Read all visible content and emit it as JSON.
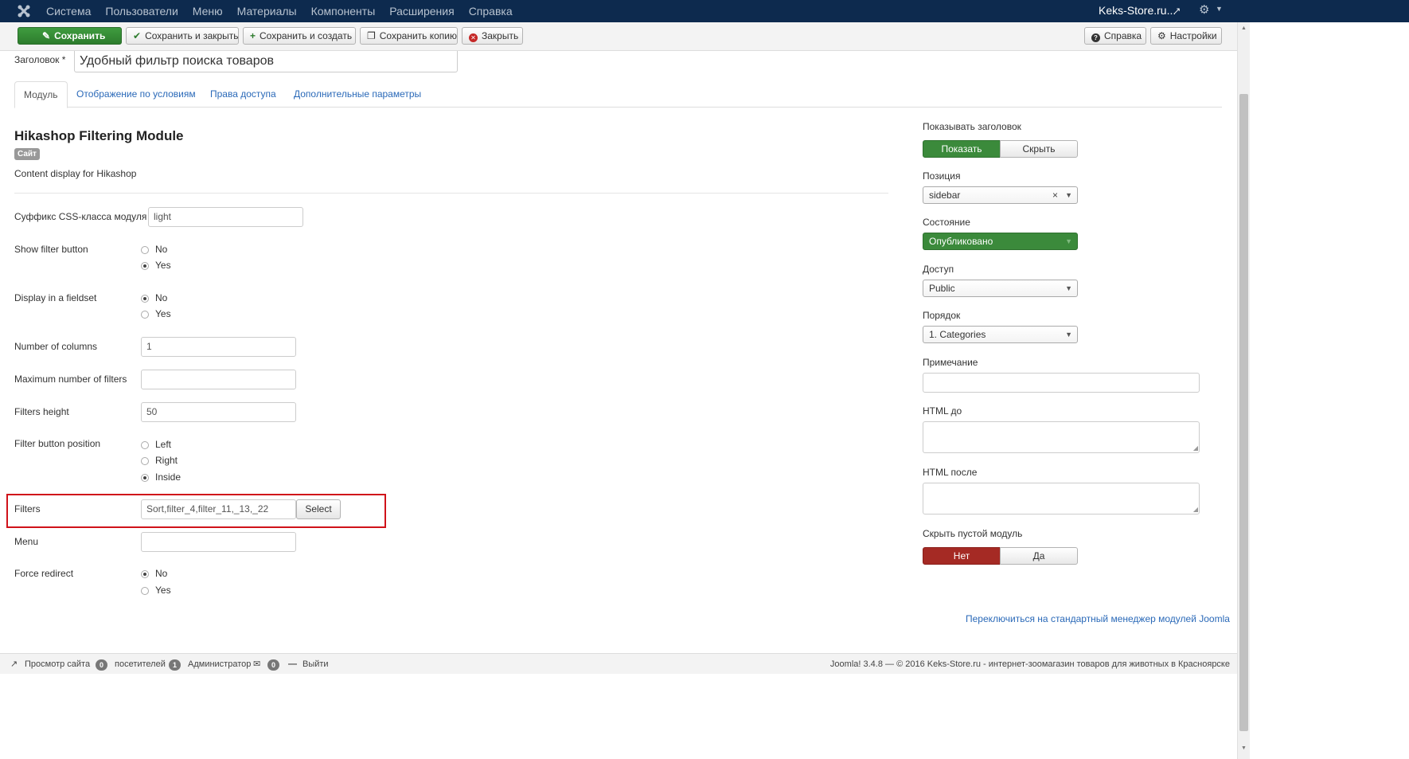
{
  "navbar": {
    "menu": [
      "Система",
      "Пользователи",
      "Меню",
      "Материалы",
      "Компоненты",
      "Расширения",
      "Справка"
    ],
    "site_name": "Keks-Store.ru..."
  },
  "toolbar": {
    "save": "Сохранить",
    "save_close": "Сохранить и закрыть",
    "save_new": "Сохранить и создать",
    "save_copy": "Сохранить копию",
    "close": "Закрыть",
    "help": "Справка",
    "options": "Настройки"
  },
  "title": {
    "label": "Заголовок *",
    "value": "Удобный фильтр поиска товаров"
  },
  "tabs": [
    "Модуль",
    "Отображение по условиям",
    "Права доступа",
    "Дополнительные параметры"
  ],
  "module": {
    "name": "Hikashop Filtering Module",
    "badge": "Сайт",
    "description": "Content display for Hikashop"
  },
  "form": {
    "css_suffix": {
      "label": "Суффикс CSS-класса модуля",
      "value": "light"
    },
    "show_filter_button": {
      "label": "Show filter button",
      "options": [
        "No",
        "Yes"
      ],
      "selected": "Yes"
    },
    "display_fieldset": {
      "label": "Display in a fieldset",
      "options": [
        "No",
        "Yes"
      ],
      "selected": "No"
    },
    "num_columns": {
      "label": "Number of columns",
      "value": "1"
    },
    "max_filters": {
      "label": "Maximum number of filters",
      "value": ""
    },
    "filters_height": {
      "label": "Filters height",
      "value": "50"
    },
    "filter_button_position": {
      "label": "Filter button position",
      "options": [
        "Left",
        "Right",
        "Inside"
      ],
      "selected": "Inside"
    },
    "filters": {
      "label": "Filters",
      "value": "Sort,filter_4,filter_11,_13,_22",
      "button": "Select"
    },
    "menu": {
      "label": "Menu",
      "value": ""
    },
    "force_redirect": {
      "label": "Force redirect",
      "options": [
        "No",
        "Yes"
      ],
      "selected": "No"
    }
  },
  "sidebar": {
    "show_title": {
      "label": "Показывать заголовок",
      "on": "Показать",
      "off": "Скрыть",
      "selected": "Показать"
    },
    "position": {
      "label": "Позиция",
      "value": "sidebar"
    },
    "state": {
      "label": "Состояние",
      "value": "Опубликовано"
    },
    "access": {
      "label": "Доступ",
      "value": "Public"
    },
    "ordering": {
      "label": "Порядок",
      "value": "1. Categories"
    },
    "note": {
      "label": "Примечание",
      "value": ""
    },
    "html_before": {
      "label": "HTML до"
    },
    "html_after": {
      "label": "HTML после"
    },
    "hide_empty": {
      "label": "Скрыть пустой модуль",
      "on": "Нет",
      "off": "Да",
      "selected": "Нет"
    }
  },
  "switch_link": "Переключиться на стандартный менеджер модулей Joomla",
  "statusbar": {
    "view_site": "Просмотр сайта",
    "visitors_count": "0",
    "visitors_label": "посетителей",
    "admins_count": "1",
    "admins_label": "Администратор",
    "messages_count": "0",
    "logout": "Выйти",
    "copyright": "Joomla! 3.4.8 — © 2016 Keks-Store.ru - интернет-зоомагазин товаров для животных в Красноярске"
  },
  "colors": {
    "navbar": "#0d2a4e",
    "primary_green": "#3b8a3b",
    "danger_red": "#a52a24",
    "link": "#2a69b8",
    "highlight": "#d0121a"
  }
}
